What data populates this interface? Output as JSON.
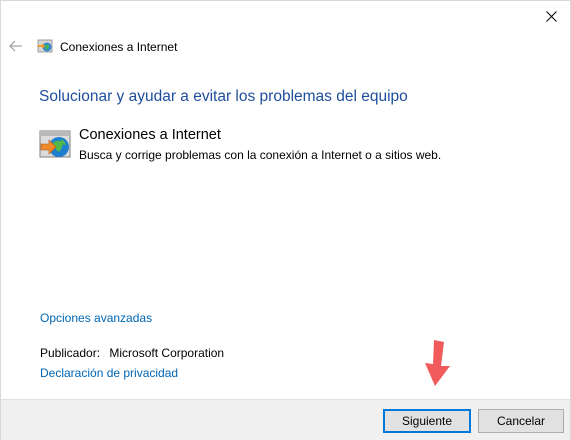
{
  "window": {
    "title": "Conexiones a Internet"
  },
  "main": {
    "heading": "Solucionar y ayudar a evitar los problemas del equipo",
    "item": {
      "title": "Conexiones a Internet",
      "description": "Busca y corrige problemas con la conexión a Internet o a sitios web.",
      "icon": "internet-connections-icon"
    },
    "advanced_link": "Opciones avanzadas",
    "publisher_label": "Publicador:",
    "publisher_value": "Microsoft Corporation",
    "privacy_link": "Declaración de privacidad"
  },
  "footer": {
    "next_label": "Siguiente",
    "cancel_label": "Cancelar"
  },
  "colors": {
    "heading": "#1e4e9b",
    "link": "#0066b4",
    "annotation_arrow": "#f25b5b",
    "default_button_border": "#0078d7"
  }
}
